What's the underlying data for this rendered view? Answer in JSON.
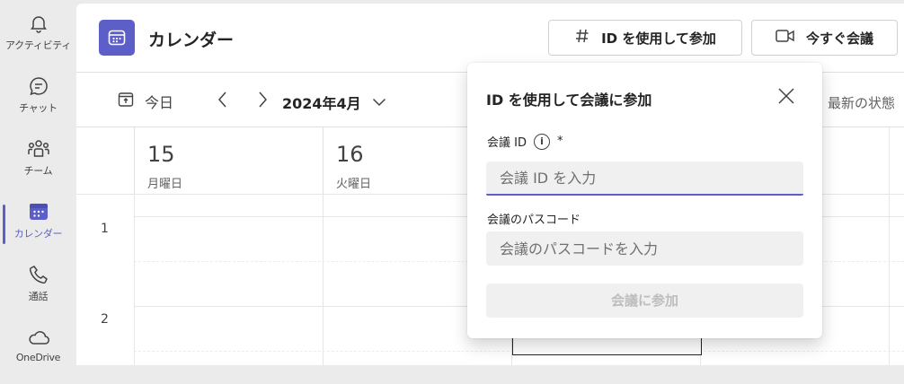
{
  "rail": {
    "items": [
      {
        "label": "アクティビティ",
        "icon": "bell-icon"
      },
      {
        "label": "チャット",
        "icon": "chat-icon"
      },
      {
        "label": "チーム",
        "icon": "teams-icon"
      },
      {
        "label": "カレンダー",
        "icon": "calendar-icon",
        "active": true
      },
      {
        "label": "通話",
        "icon": "phone-icon"
      },
      {
        "label": "OneDrive",
        "icon": "cloud-icon"
      }
    ]
  },
  "header": {
    "title": "カレンダー",
    "join_id_label": "ID を使用して参加",
    "meet_now_label": "今すぐ会議"
  },
  "toolbar": {
    "today_label": "今日",
    "month_label": "2024年4月",
    "latest_label": "最新の状態"
  },
  "calendar": {
    "days": [
      {
        "num": "15",
        "name": "月曜日"
      },
      {
        "num": "16",
        "name": "火曜日"
      }
    ],
    "hours": [
      "1",
      "2"
    ]
  },
  "dialog": {
    "title": "ID を使用して会議に参加",
    "meeting_id_label": "会議 ID",
    "required_mark": "*",
    "info_glyph": "i",
    "meeting_id_placeholder": "会議 ID を入力",
    "passcode_label": "会議のパスコード",
    "passcode_placeholder": "会議のパスコードを入力",
    "submit_label": "会議に参加"
  },
  "colors": {
    "accent": "#5b5fc7",
    "rail_bg": "#ebebeb",
    "disabled_text": "#bdbdbd"
  }
}
